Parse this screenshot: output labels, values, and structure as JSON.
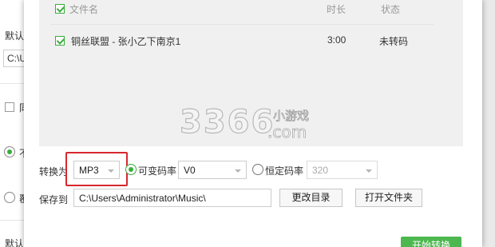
{
  "background_panel": {
    "label_top": "默认",
    "path_value": "C:\\U",
    "checkbox_label": "同",
    "radio_1_label": "不",
    "radio_2_label": "覆",
    "label_bottom": "默认"
  },
  "list": {
    "columns": {
      "name": "文件名",
      "duration": "时长",
      "status": "状态"
    },
    "rows": [
      {
        "name": "铜丝联盟 - 张小乙下南京1",
        "duration": "3:00",
        "status": "未转码"
      }
    ]
  },
  "watermark": {
    "digits": "3366",
    "small": "小游戏",
    "domain": ".com"
  },
  "convert": {
    "label": "转换为",
    "format": "MP3",
    "vbr_label": "可变码率",
    "vbr_value": "V0",
    "cbr_label": "恒定码率",
    "cbr_value": "320"
  },
  "save": {
    "label": "保存到",
    "path": "C:\\Users\\Administrator\\Music\\",
    "change_dir_label": "更改目录",
    "open_folder_label": "打开文件夹"
  },
  "start_button_label": "开始转换",
  "colors": {
    "accent_green": "#3bab3b",
    "highlight_red": "#d7282f"
  }
}
